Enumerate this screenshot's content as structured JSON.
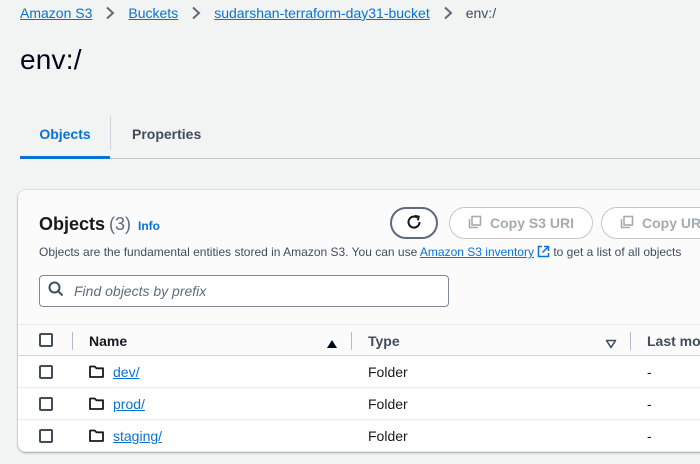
{
  "breadcrumb": {
    "items": [
      "Amazon S3",
      "Buckets",
      "sudarshan-terraform-day31-bucket"
    ],
    "current": "env:/"
  },
  "page_title": "env:/",
  "tabs": [
    {
      "label": "Objects",
      "active": true
    },
    {
      "label": "Properties",
      "active": false
    }
  ],
  "objects_panel": {
    "title": "Objects",
    "count": "(3)",
    "info_label": "Info",
    "description_before": "Objects are the fundamental entities stored in Amazon S3. You can use ",
    "description_link": "Amazon S3 inventory",
    "description_after": " to get a list of all objects",
    "buttons": {
      "refresh_icon": "refresh-icon",
      "copy_s3_uri": "Copy S3 URI",
      "copy_url": "Copy UR"
    },
    "search": {
      "placeholder": "Find objects by prefix",
      "value": ""
    },
    "columns": [
      "Name",
      "Type",
      "Last mo"
    ],
    "rows": [
      {
        "name": "dev/",
        "type": "Folder",
        "last_modified": "-"
      },
      {
        "name": "prod/",
        "type": "Folder",
        "last_modified": "-"
      },
      {
        "name": "staging/",
        "type": "Folder",
        "last_modified": "-"
      }
    ]
  },
  "colors": {
    "accent": "#0972d3",
    "background": "#f2f3f3",
    "text": "#16191f",
    "disabled": "#a5abb2"
  }
}
